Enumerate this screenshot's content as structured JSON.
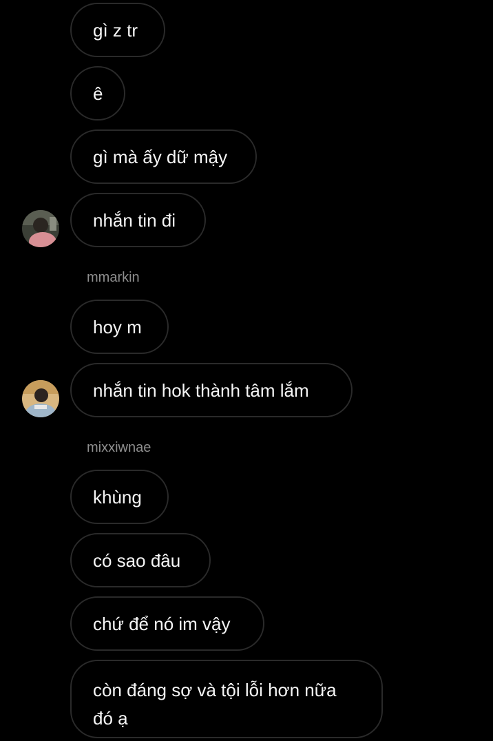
{
  "colors": {
    "background": "#000000",
    "bubble_border": "#2a2a2a",
    "message_text": "#f5f5f5",
    "sender_text": "#8e8e8e"
  },
  "messages": [
    {
      "text": "gì z tr"
    },
    {
      "text": "ê"
    },
    {
      "text": "gì mà ấy dữ mậy"
    },
    {
      "text": "nhắn tin đi",
      "avatar": "user-avatar-1"
    },
    {
      "sender": "mmarkin"
    },
    {
      "text": "hoy m"
    },
    {
      "text": "nhắn tin hok thành tâm lắm",
      "avatar": "user-avatar-2"
    },
    {
      "sender": "mixxiwnae"
    },
    {
      "text": "khùng"
    },
    {
      "text": "có sao đâu"
    },
    {
      "text": "chứ để nó im vậy"
    },
    {
      "text": "còn đáng sợ và tội lỗi hơn nữa đó ạ"
    }
  ]
}
